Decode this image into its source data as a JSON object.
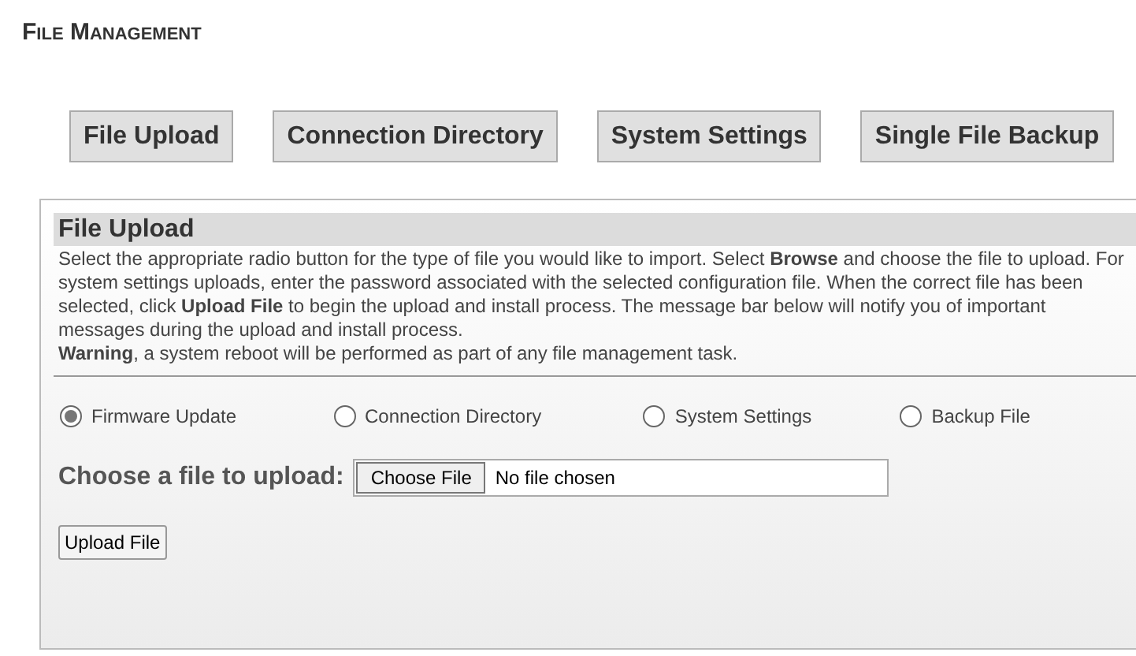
{
  "page_title": "File Management",
  "tabs": [
    {
      "label": "File Upload",
      "selected": false
    },
    {
      "label": "Connection Directory",
      "selected": false
    },
    {
      "label": "System Settings",
      "selected": false
    },
    {
      "label": "Single File Backup",
      "selected": false
    }
  ],
  "panel": {
    "title": "File Upload",
    "paragraphs": [
      "Select the appropriate radio button for the type of file you would like to import. Select **Browse** and choose the file to upload. For system settings uploads, enter the password associated with the selected configuration file. When the correct file has been selected, click **Upload File** to begin the upload and install process. The message bar below will notify you of important messages during the upload and install process.",
      "**Warning**, a system reboot will be performed as part of any file management task."
    ],
    "file_types": [
      {
        "label": "Firmware Update",
        "selected": true
      },
      {
        "label": "Connection Directory",
        "selected": false
      },
      {
        "label": "System Settings",
        "selected": false
      },
      {
        "label": "Backup File",
        "selected": false
      }
    ],
    "file_label": "Choose a file to upload:",
    "choose_button": "Choose File",
    "file_status": "No file chosen",
    "upload_button": "Upload File"
  }
}
